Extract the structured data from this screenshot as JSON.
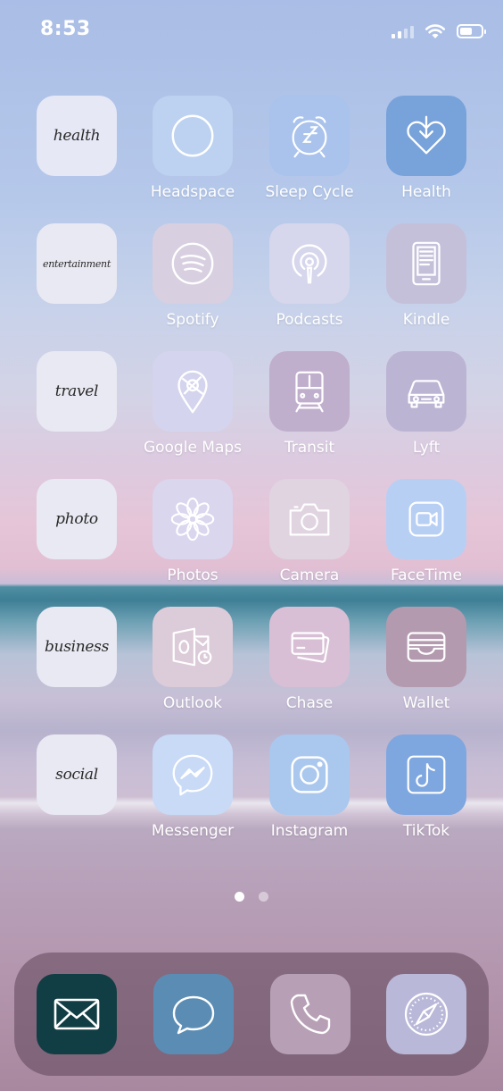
{
  "status_bar": {
    "time": "8:53"
  },
  "widgets": [
    {
      "text": "health"
    },
    {
      "text": "entertainment"
    },
    {
      "text": "travel"
    },
    {
      "text": "photo"
    },
    {
      "text": "business"
    },
    {
      "text": "social"
    }
  ],
  "apps": [
    {
      "label": "Headspace",
      "icon": "headspace-icon",
      "color": "#bcd2f0"
    },
    {
      "label": "Sleep Cycle",
      "icon": "alarm-clock-icon",
      "color": "#a9c3ec"
    },
    {
      "label": "Health",
      "icon": "heart-download-icon",
      "color": "#78a2da"
    },
    {
      "label": "Spotify",
      "icon": "spotify-icon",
      "color": "#d8cfe0"
    },
    {
      "label": "Podcasts",
      "icon": "podcasts-icon",
      "color": "#d6d6ec"
    },
    {
      "label": "Kindle",
      "icon": "ereader-icon",
      "color": "#c5c0da"
    },
    {
      "label": "Google Maps",
      "icon": "map-pin-icon",
      "color": "#d4d4ee"
    },
    {
      "label": "Transit",
      "icon": "train-icon",
      "color": "#c0aecd"
    },
    {
      "label": "Lyft",
      "icon": "car-icon",
      "color": "#bcb4d3"
    },
    {
      "label": "Photos",
      "icon": "flower-icon",
      "color": "#d9d6ee"
    },
    {
      "label": "Camera",
      "icon": "camera-icon",
      "color": "#e0d4e1"
    },
    {
      "label": "FaceTime",
      "icon": "video-camera-icon",
      "color": "#b8cff4"
    },
    {
      "label": "Outlook",
      "icon": "outlook-icon",
      "color": "#dccbd8"
    },
    {
      "label": "Chase",
      "icon": "credit-cards-icon",
      "color": "#d8bfd5"
    },
    {
      "label": "Wallet",
      "icon": "wallet-icon",
      "color": "#b39aaf"
    },
    {
      "label": "Messenger",
      "icon": "messenger-icon",
      "color": "#c8daf6"
    },
    {
      "label": "Instagram",
      "icon": "instagram-icon",
      "color": "#aac7ee"
    },
    {
      "label": "TikTok",
      "icon": "tiktok-icon",
      "color": "#7ea6df"
    }
  ],
  "page_indicator": {
    "pages": 2,
    "current": 1
  },
  "dock": [
    {
      "icon": "mail-icon",
      "color": "#103e44"
    },
    {
      "icon": "message-bubble-icon",
      "color": "#5b8db4"
    },
    {
      "icon": "phone-icon",
      "color": "#b7a0b5"
    },
    {
      "icon": "compass-icon",
      "color": "#b9b8d8"
    }
  ]
}
